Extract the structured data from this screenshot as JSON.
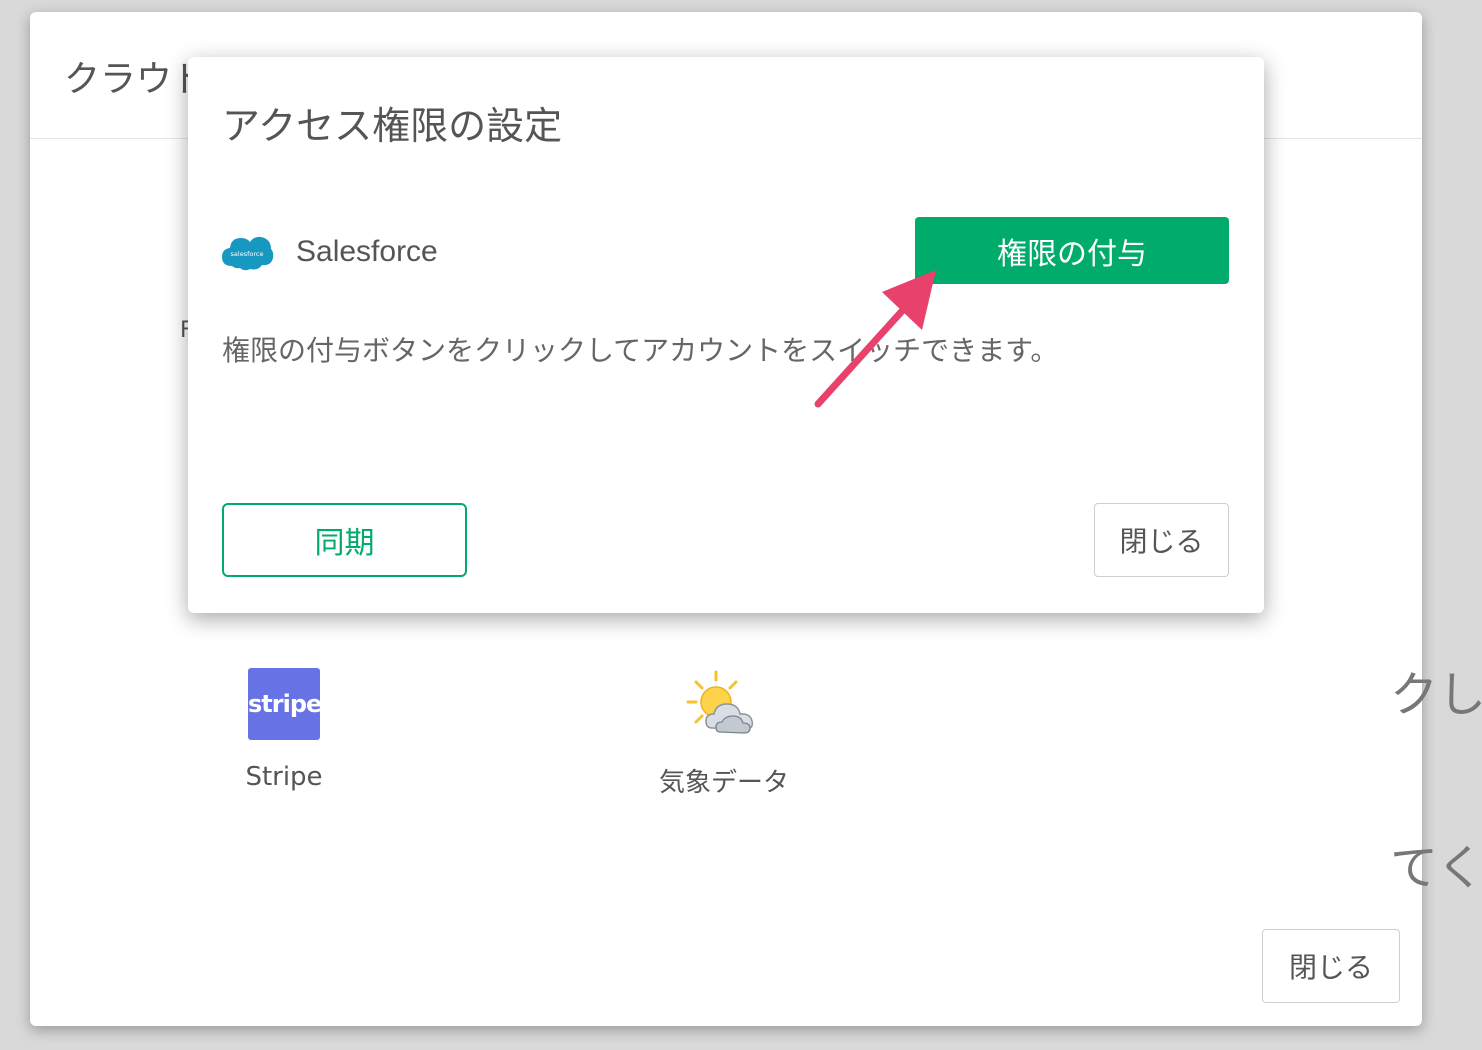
{
  "background_modal": {
    "title": "クラウドアプリケーションデータ",
    "stray_letter": "F",
    "side_text_1": "クし",
    "side_text_2": "てく",
    "services": [
      {
        "label": "Stripe",
        "icon": "stripe-logo",
        "logo_text": "stripe"
      },
      {
        "label": "気象データ",
        "icon": "weather-sun-cloud-icon"
      }
    ],
    "close_label": "閉じる"
  },
  "dialog": {
    "title": "アクセス権限の設定",
    "provider_name": "Salesforce",
    "provider_logo_text": "salesforce",
    "grant_label": "権限の付与",
    "description": "権限の付与ボタンをクリックしてアカウントをスイッチできます。",
    "sync_label": "同期",
    "close_label": "閉じる"
  },
  "colors": {
    "accent_green": "#00ab6b",
    "salesforce_blue": "#1798c1",
    "stripe_purple": "#6772e5",
    "annotation_arrow": "#e8416b"
  }
}
